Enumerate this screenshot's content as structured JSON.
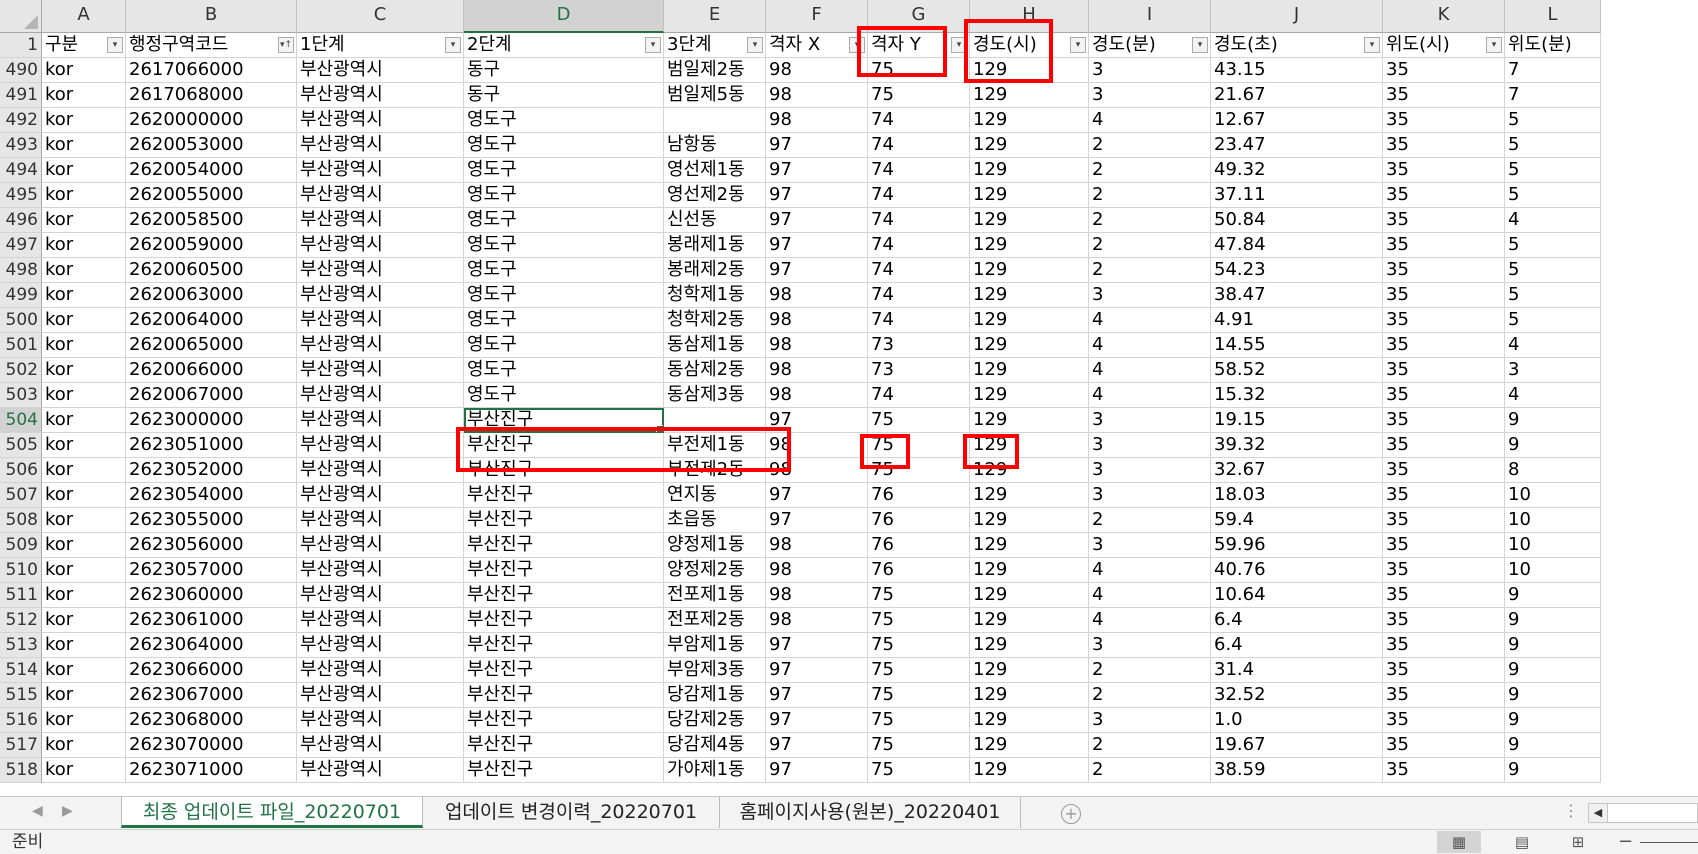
{
  "columns": {
    "letters": [
      "A",
      "B",
      "C",
      "D",
      "E",
      "F",
      "G",
      "H",
      "I",
      "J",
      "K",
      "L"
    ],
    "active_letter": "D"
  },
  "header_row": {
    "row_number": "1",
    "cells": [
      "구분",
      "행정구역코드",
      "1단계",
      "2단계",
      "3단계",
      "격자 X",
      "격자 Y",
      "경도(시)",
      "경도(분)",
      "경도(초)",
      "위도(시)",
      "위도(분)"
    ]
  },
  "rows": [
    {
      "num": "490",
      "cells": [
        "kor",
        "2617066000",
        "부산광역시",
        "동구",
        "범일제2동",
        "98",
        "75",
        "129",
        "3",
        "43.15",
        "35",
        "7"
      ]
    },
    {
      "num": "491",
      "cells": [
        "kor",
        "2617068000",
        "부산광역시",
        "동구",
        "범일제5동",
        "98",
        "75",
        "129",
        "3",
        "21.67",
        "35",
        "7"
      ]
    },
    {
      "num": "492",
      "cells": [
        "kor",
        "2620000000",
        "부산광역시",
        "영도구",
        "",
        "98",
        "74",
        "129",
        "4",
        "12.67",
        "35",
        "5"
      ]
    },
    {
      "num": "493",
      "cells": [
        "kor",
        "2620053000",
        "부산광역시",
        "영도구",
        "남항동",
        "97",
        "74",
        "129",
        "2",
        "23.47",
        "35",
        "5"
      ]
    },
    {
      "num": "494",
      "cells": [
        "kor",
        "2620054000",
        "부산광역시",
        "영도구",
        "영선제1동",
        "97",
        "74",
        "129",
        "2",
        "49.32",
        "35",
        "5"
      ]
    },
    {
      "num": "495",
      "cells": [
        "kor",
        "2620055000",
        "부산광역시",
        "영도구",
        "영선제2동",
        "97",
        "74",
        "129",
        "2",
        "37.11",
        "35",
        "5"
      ]
    },
    {
      "num": "496",
      "cells": [
        "kor",
        "2620058500",
        "부산광역시",
        "영도구",
        "신선동",
        "97",
        "74",
        "129",
        "2",
        "50.84",
        "35",
        "4"
      ]
    },
    {
      "num": "497",
      "cells": [
        "kor",
        "2620059000",
        "부산광역시",
        "영도구",
        "봉래제1동",
        "97",
        "74",
        "129",
        "2",
        "47.84",
        "35",
        "5"
      ]
    },
    {
      "num": "498",
      "cells": [
        "kor",
        "2620060500",
        "부산광역시",
        "영도구",
        "봉래제2동",
        "97",
        "74",
        "129",
        "2",
        "54.23",
        "35",
        "5"
      ]
    },
    {
      "num": "499",
      "cells": [
        "kor",
        "2620063000",
        "부산광역시",
        "영도구",
        "청학제1동",
        "98",
        "74",
        "129",
        "3",
        "38.47",
        "35",
        "5"
      ]
    },
    {
      "num": "500",
      "cells": [
        "kor",
        "2620064000",
        "부산광역시",
        "영도구",
        "청학제2동",
        "98",
        "74",
        "129",
        "4",
        "4.91",
        "35",
        "5"
      ]
    },
    {
      "num": "501",
      "cells": [
        "kor",
        "2620065000",
        "부산광역시",
        "영도구",
        "동삼제1동",
        "98",
        "73",
        "129",
        "4",
        "14.55",
        "35",
        "4"
      ]
    },
    {
      "num": "502",
      "cells": [
        "kor",
        "2620066000",
        "부산광역시",
        "영도구",
        "동삼제2동",
        "98",
        "73",
        "129",
        "4",
        "58.52",
        "35",
        "3"
      ]
    },
    {
      "num": "503",
      "cells": [
        "kor",
        "2620067000",
        "부산광역시",
        "영도구",
        "동삼제3동",
        "98",
        "74",
        "129",
        "4",
        "15.32",
        "35",
        "4"
      ]
    },
    {
      "num": "504",
      "cells": [
        "kor",
        "2623000000",
        "부산광역시",
        "부산진구",
        "",
        "97",
        "75",
        "129",
        "3",
        "19.15",
        "35",
        "9"
      ]
    },
    {
      "num": "505",
      "cells": [
        "kor",
        "2623051000",
        "부산광역시",
        "부산진구",
        "부전제1동",
        "98",
        "75",
        "129",
        "3",
        "39.32",
        "35",
        "9"
      ]
    },
    {
      "num": "506",
      "cells": [
        "kor",
        "2623052000",
        "부산광역시",
        "부산진구",
        "부전제2동",
        "98",
        "75",
        "129",
        "3",
        "32.67",
        "35",
        "8"
      ]
    },
    {
      "num": "507",
      "cells": [
        "kor",
        "2623054000",
        "부산광역시",
        "부산진구",
        "연지동",
        "97",
        "76",
        "129",
        "3",
        "18.03",
        "35",
        "10"
      ]
    },
    {
      "num": "508",
      "cells": [
        "kor",
        "2623055000",
        "부산광역시",
        "부산진구",
        "초읍동",
        "97",
        "76",
        "129",
        "2",
        "59.4",
        "35",
        "10"
      ]
    },
    {
      "num": "509",
      "cells": [
        "kor",
        "2623056000",
        "부산광역시",
        "부산진구",
        "양정제1동",
        "98",
        "76",
        "129",
        "3",
        "59.96",
        "35",
        "10"
      ]
    },
    {
      "num": "510",
      "cells": [
        "kor",
        "2623057000",
        "부산광역시",
        "부산진구",
        "양정제2동",
        "98",
        "76",
        "129",
        "4",
        "40.76",
        "35",
        "10"
      ]
    },
    {
      "num": "511",
      "cells": [
        "kor",
        "2623060000",
        "부산광역시",
        "부산진구",
        "전포제1동",
        "98",
        "75",
        "129",
        "4",
        "10.64",
        "35",
        "9"
      ]
    },
    {
      "num": "512",
      "cells": [
        "kor",
        "2623061000",
        "부산광역시",
        "부산진구",
        "전포제2동",
        "98",
        "75",
        "129",
        "4",
        "6.4",
        "35",
        "9"
      ]
    },
    {
      "num": "513",
      "cells": [
        "kor",
        "2623064000",
        "부산광역시",
        "부산진구",
        "부암제1동",
        "97",
        "75",
        "129",
        "3",
        "6.4",
        "35",
        "9"
      ]
    },
    {
      "num": "514",
      "cells": [
        "kor",
        "2623066000",
        "부산광역시",
        "부산진구",
        "부암제3동",
        "97",
        "75",
        "129",
        "2",
        "31.4",
        "35",
        "9"
      ]
    },
    {
      "num": "515",
      "cells": [
        "kor",
        "2623067000",
        "부산광역시",
        "부산진구",
        "당감제1동",
        "97",
        "75",
        "129",
        "2",
        "32.52",
        "35",
        "9"
      ]
    },
    {
      "num": "516",
      "cells": [
        "kor",
        "2623068000",
        "부산광역시",
        "부산진구",
        "당감제2동",
        "97",
        "75",
        "129",
        "3",
        "1.0",
        "35",
        "9"
      ]
    },
    {
      "num": "517",
      "cells": [
        "kor",
        "2623070000",
        "부산광역시",
        "부산진구",
        "당감제4동",
        "97",
        "75",
        "129",
        "2",
        "19.67",
        "35",
        "9"
      ]
    },
    {
      "num": "518",
      "cells": [
        "kor",
        "2623071000",
        "부산광역시",
        "부산진구",
        "가야제1동",
        "97",
        "75",
        "129",
        "2",
        "38.59",
        "35",
        "9"
      ]
    }
  ],
  "active_row_number": "504",
  "sheet_tabs": [
    {
      "label": "최종 업데이트 파일_20220701",
      "active": true
    },
    {
      "label": "업데이트 변경이력_20220701",
      "active": false
    },
    {
      "label": "홈페이지사용(원본)_20220401",
      "active": false
    }
  ],
  "status": {
    "mode_text": "준비"
  },
  "accent_color": "#217346",
  "highlight_color": "#ff0000"
}
